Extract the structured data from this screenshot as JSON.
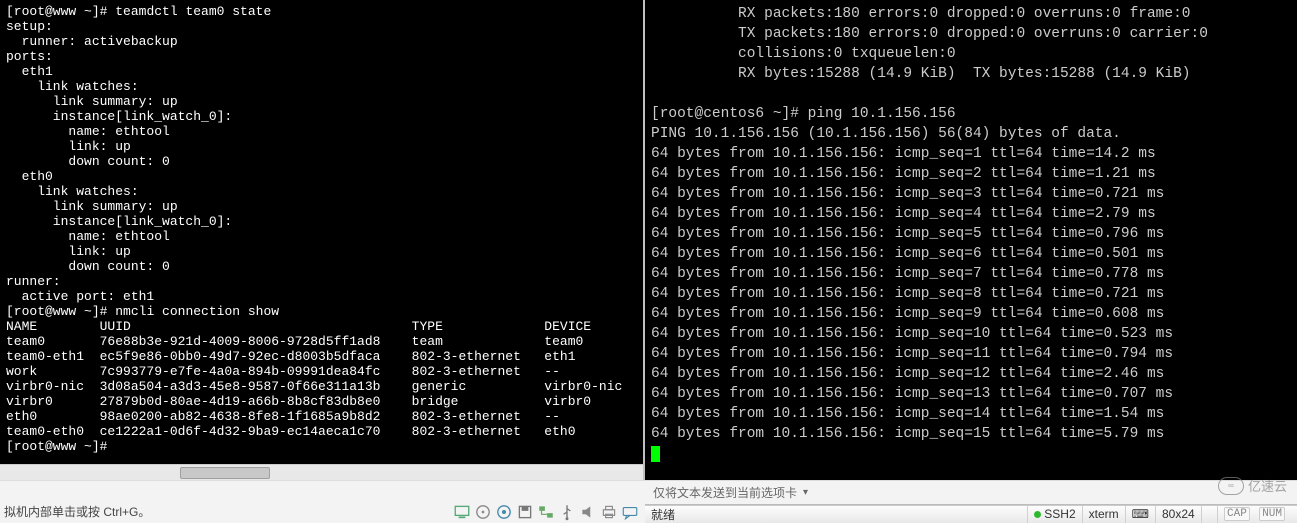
{
  "left": {
    "prompt1": "[root@www ~]#",
    "cmd1": "teamdctl team0 state",
    "out": [
      "setup:",
      "  runner: activebackup",
      "ports:",
      "  eth1",
      "    link watches:",
      "      link summary: up",
      "      instance[link_watch_0]:",
      "        name: ethtool",
      "        link: up",
      "        down count: 0",
      "  eth0",
      "    link watches:",
      "      link summary: up",
      "      instance[link_watch_0]:",
      "        name: ethtool",
      "        link: up",
      "        down count: 0",
      "runner:",
      "  active port: eth1"
    ],
    "cmd2": "nmcli connection show",
    "table_header": [
      "NAME",
      "UUID",
      "TYPE",
      "DEVICE"
    ],
    "table_rows": [
      [
        "team0",
        "76e88b3e-921d-4009-8006-9728d5ff1ad8",
        "team",
        "team0"
      ],
      [
        "team0-eth1",
        "ec5f9e86-0bb0-49d7-92ec-d8003b5dfaca",
        "802-3-ethernet",
        "eth1"
      ],
      [
        "work",
        "7c993779-e7fe-4a0a-894b-09991dea84fc",
        "802-3-ethernet",
        "--"
      ],
      [
        "virbr0-nic",
        "3d08a504-a3d3-45e8-9587-0f66e311a13b",
        "generic",
        "virbr0-nic"
      ],
      [
        "virbr0",
        "27879b0d-80ae-4d19-a66b-8b8cf83db8e0",
        "bridge",
        "virbr0"
      ],
      [
        "eth0",
        "98ae0200-ab82-4638-8fe8-1f1685a9b8d2",
        "802-3-ethernet",
        "--"
      ],
      [
        "team0-eth0",
        "ce1222a1-0d6f-4d32-9ba9-ec14aeca1c70",
        "802-3-ethernet",
        "eth0"
      ]
    ],
    "prompt_end": "[root@www ~]#"
  },
  "right": {
    "header_lines": [
      "          RX packets:180 errors:0 dropped:0 overruns:0 frame:0",
      "          TX packets:180 errors:0 dropped:0 overruns:0 carrier:0",
      "          collisions:0 txqueuelen:0",
      "          RX bytes:15288 (14.9 KiB)  TX bytes:15288 (14.9 KiB)"
    ],
    "prompt": "[root@centos6 ~]#",
    "cmd": "ping 10.1.156.156",
    "ping_hdr": "PING 10.1.156.156 (10.1.156.156) 56(84) bytes of data.",
    "pings": [
      {
        "seq": 1,
        "ttl": 64,
        "time": "14.2 ms"
      },
      {
        "seq": 2,
        "ttl": 64,
        "time": "1.21 ms"
      },
      {
        "seq": 3,
        "ttl": 64,
        "time": "0.721 ms"
      },
      {
        "seq": 4,
        "ttl": 64,
        "time": "2.79 ms"
      },
      {
        "seq": 5,
        "ttl": 64,
        "time": "0.796 ms"
      },
      {
        "seq": 6,
        "ttl": 64,
        "time": "0.501 ms"
      },
      {
        "seq": 7,
        "ttl": 64,
        "time": "0.778 ms"
      },
      {
        "seq": 8,
        "ttl": 64,
        "time": "0.721 ms"
      },
      {
        "seq": 9,
        "ttl": 64,
        "time": "0.608 ms"
      },
      {
        "seq": 10,
        "ttl": 64,
        "time": "0.523 ms"
      },
      {
        "seq": 11,
        "ttl": 64,
        "time": "0.794 ms"
      },
      {
        "seq": 12,
        "ttl": 64,
        "time": "2.46 ms"
      },
      {
        "seq": 13,
        "ttl": 64,
        "time": "0.707 ms"
      },
      {
        "seq": 14,
        "ttl": 64,
        "time": "1.54 ms"
      },
      {
        "seq": 15,
        "ttl": 64,
        "time": "5.79 ms"
      }
    ],
    "ping_ip": "10.1.156.156",
    "ping_prefix": "64 bytes from"
  },
  "tabbar": {
    "text": "仅将文本发送到当前选项卡"
  },
  "statusbar": {
    "ready": "就绪",
    "ssh": "SSH2",
    "term": "xterm",
    "size": "80x24",
    "caps": "CAP",
    "num": "NUM"
  },
  "footer": {
    "hint": "拟机内部单击或按 Ctrl+G。"
  },
  "watermark": "亿速云"
}
